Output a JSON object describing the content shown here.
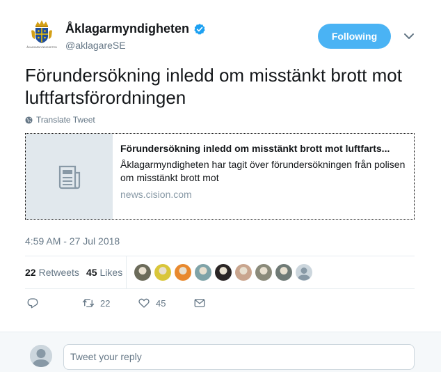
{
  "author": {
    "name": "Åklagarmyndigheten",
    "handle": "@aklagareSE",
    "logo_caption": "ÅKLAGARMYNDIGHETEN",
    "verified": true
  },
  "follow_button": {
    "label": "Following"
  },
  "tweet": {
    "text": "Förundersökning inledd om misstänkt brott mot luftfartsförordningen",
    "translate_label": "Translate Tweet",
    "timestamp": "4:59 AM - 27 Jul 2018"
  },
  "card": {
    "title": "Förundersökning inledd om misstänkt brott mot luftfarts...",
    "description": "Åklagarmyndigheten har tagit över förundersökningen från polisen om misstänkt brott mot",
    "domain": "news.cision.com"
  },
  "stats": {
    "retweets_count": "22",
    "retweets_label": "Retweets",
    "likes_count": "45",
    "likes_label": "Likes"
  },
  "likers": [
    {
      "color": "#6b6b5a",
      "icon": "liker-avatar"
    },
    {
      "color": "#d9c63a",
      "icon": "liker-avatar"
    },
    {
      "color": "#e8892e",
      "icon": "liker-avatar"
    },
    {
      "color": "#7fa3a8",
      "icon": "liker-avatar"
    },
    {
      "color": "#2a2525",
      "icon": "liker-avatar"
    },
    {
      "color": "#c9a58e",
      "icon": "liker-avatar"
    },
    {
      "color": "#8a8a7a",
      "icon": "liker-avatar"
    },
    {
      "color": "#6f7a76",
      "icon": "liker-avatar"
    },
    {
      "color": "#ccd6dd",
      "icon": "default-avatar"
    }
  ],
  "actions": {
    "reply_count": "",
    "retweet_count": "22",
    "like_count": "45"
  },
  "reply": {
    "placeholder": "Tweet your reply"
  },
  "colors": {
    "accent": "#4ab3f4",
    "verified": "#1da1f2",
    "muted": "#657786"
  }
}
